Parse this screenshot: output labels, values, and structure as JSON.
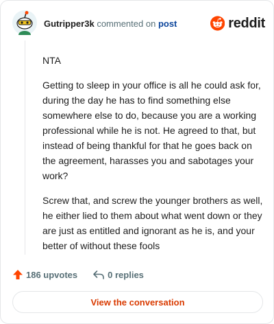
{
  "comment": {
    "author": "Gutripper3k",
    "action_text": "commented on",
    "target_link": "post",
    "paragraphs": [
      "NTA",
      "Getting to sleep in your office is all he could ask for, during the day he has to find something else somewhere else to do, because you are a working professional while he is not. He agreed to that, but instead of being thankful for that he goes back on the agreement, harasses you and sabotages your work?",
      "Screw that, and screw the younger brothers as well, he either lied to them about what went down or they are just as entitled and ignorant as he is, and your better of without these fools"
    ]
  },
  "brand": {
    "wordmark": "reddit",
    "icon": "reddit-logo-icon",
    "color": "#ff4500"
  },
  "stats": {
    "upvotes_label": "186 upvotes",
    "upvote_icon": "upvote-arrow-icon",
    "upvote_color": "#ff4500",
    "replies_label": "0 replies",
    "reply_icon": "reply-arrow-icon"
  },
  "cta": {
    "label": "View the conversation",
    "color": "#d93a00"
  }
}
